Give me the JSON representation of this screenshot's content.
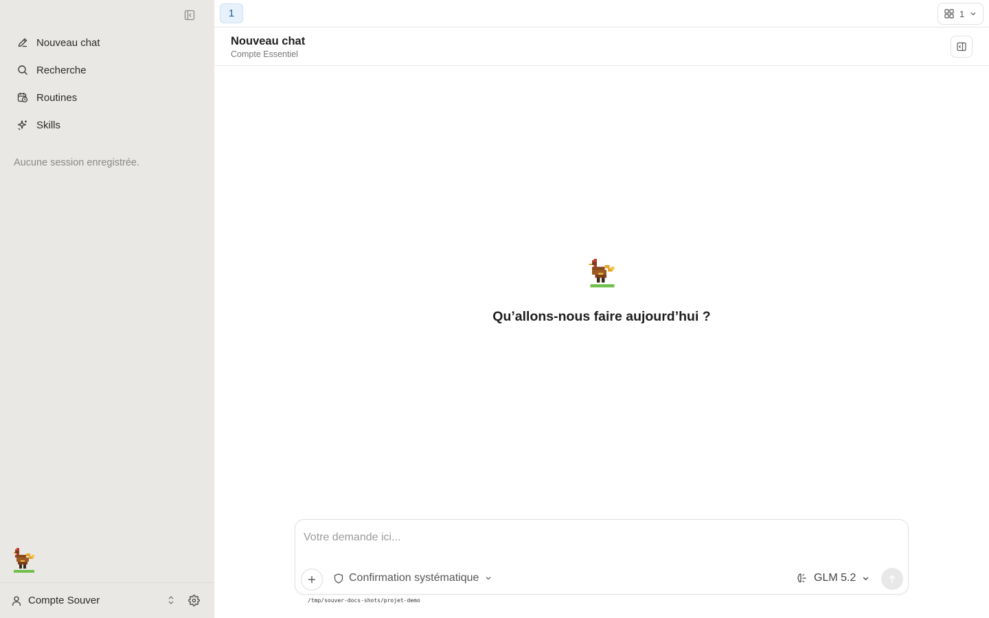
{
  "sidebar": {
    "items": [
      {
        "label": "Nouveau chat",
        "icon": "pencil-icon"
      },
      {
        "label": "Recherche",
        "icon": "search-icon"
      },
      {
        "label": "Routines",
        "icon": "calendar-clock-icon"
      },
      {
        "label": "Skills",
        "icon": "sparkle-icon"
      }
    ],
    "empty_sessions": "Aucune session enregistrée.",
    "account_name": "Compte Souver"
  },
  "tabbar": {
    "active_tab": "1",
    "layout_count": "1"
  },
  "header": {
    "title": "Nouveau chat",
    "subtitle": "Compte Essentiel"
  },
  "hero": {
    "title": "Qu’allons-nous faire aujourd’hui ?"
  },
  "composer": {
    "placeholder": "Votre demande ici...",
    "permission_mode": "Confirmation systématique",
    "model": "GLM 5.2",
    "working_dir": "/tmp/souver-docs-shots/projet-demo"
  },
  "colors": {
    "sidebar_bg": "#eae8e4",
    "tab_active_bg": "#e7f1fb",
    "tab_active_text": "#1f5f9e"
  }
}
